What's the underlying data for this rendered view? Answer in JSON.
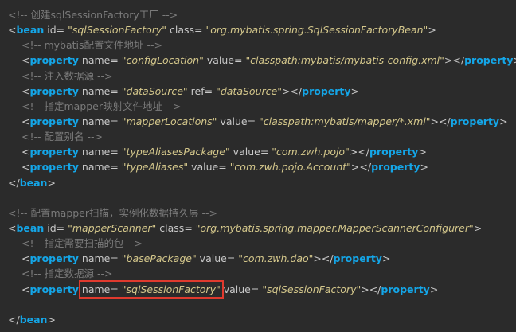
{
  "lines": [
    {
      "type": "comment",
      "indent": 0,
      "text": "<!-- 创建sqlSessionFactory工厂 -->"
    },
    {
      "type": "open",
      "indent": 0,
      "tag": "bean",
      "attrs": [
        {
          "name": "id",
          "value": "sqlSessionFactory"
        },
        {
          "name": "class",
          "value": "org.mybatis.spring.SqlSessionFactoryBean"
        }
      ]
    },
    {
      "type": "comment",
      "indent": 1,
      "text": "<!-- mybatis配置文件地址 -->"
    },
    {
      "type": "element",
      "indent": 1,
      "tag": "property",
      "attrs": [
        {
          "name": "name",
          "value": "configLocation"
        },
        {
          "name": "value",
          "value": "classpath:mybatis/mybatis-config.xml"
        }
      ]
    },
    {
      "type": "comment",
      "indent": 1,
      "text": "<!-- 注入数据源 -->"
    },
    {
      "type": "element",
      "indent": 1,
      "tag": "property",
      "attrs": [
        {
          "name": "name",
          "value": "dataSource"
        },
        {
          "name": "ref",
          "value": "dataSource"
        }
      ]
    },
    {
      "type": "comment",
      "indent": 1,
      "text": "<!-- 指定mapper映射文件地址 -->"
    },
    {
      "type": "element",
      "indent": 1,
      "tag": "property",
      "attrs": [
        {
          "name": "name",
          "value": "mapperLocations"
        },
        {
          "name": "value",
          "value": "classpath:mybatis/mapper/*.xml"
        }
      ]
    },
    {
      "type": "comment",
      "indent": 1,
      "text": "<!-- 配置别名 -->"
    },
    {
      "type": "element",
      "indent": 1,
      "tag": "property",
      "attrs": [
        {
          "name": "name",
          "value": "typeAliasesPackage"
        },
        {
          "name": "value",
          "value": "com.zwh.pojo"
        }
      ]
    },
    {
      "type": "element",
      "indent": 1,
      "tag": "property",
      "attrs": [
        {
          "name": "name",
          "value": "typeAliases"
        },
        {
          "name": "value",
          "value": "com.zwh.pojo.Account"
        }
      ]
    },
    {
      "type": "close",
      "indent": 0,
      "tag": "bean"
    },
    {
      "type": "blank"
    },
    {
      "type": "comment",
      "indent": 0,
      "text": "<!-- 配置mapper扫描，实例化数据持久层 -->"
    },
    {
      "type": "open",
      "indent": 0,
      "tag": "bean",
      "attrs": [
        {
          "name": "id",
          "value": "mapperScanner"
        },
        {
          "name": "class",
          "value": "org.mybatis.spring.mapper.MapperScannerConfigurer"
        }
      ]
    },
    {
      "type": "comment",
      "indent": 1,
      "text": "<!-- 指定需要扫描的包 -->"
    },
    {
      "type": "element",
      "indent": 1,
      "tag": "property",
      "attrs": [
        {
          "name": "name",
          "value": "basePackage"
        },
        {
          "name": "value",
          "value": "com.zwh.dao"
        }
      ]
    },
    {
      "type": "comment",
      "indent": 1,
      "text": "<!-- 指定数据源 -->"
    },
    {
      "type": "element",
      "indent": 1,
      "tag": "property",
      "highlight_attr": 0,
      "attrs": [
        {
          "name": "name",
          "value": "sqlSessionFactory"
        },
        {
          "name": "value",
          "value": "sqlSessionFactory"
        }
      ]
    },
    {
      "type": "blank"
    },
    {
      "type": "close",
      "indent": 0,
      "tag": "bean"
    }
  ]
}
